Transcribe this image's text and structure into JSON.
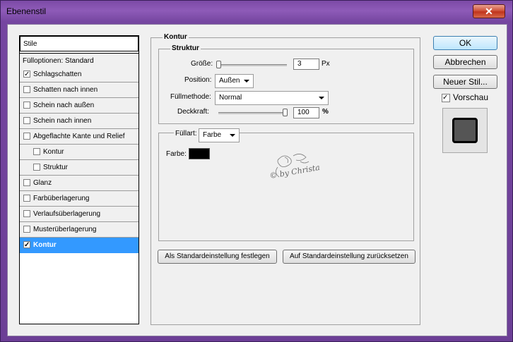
{
  "window": {
    "title": "Ebenenstil",
    "close_glyph": "✕"
  },
  "styles_list": {
    "header": "Stile",
    "items": [
      {
        "label": "Fülloptionen: Standard",
        "checkbox": false,
        "checked": false,
        "indent": 0
      },
      {
        "label": "Schlagschatten",
        "checkbox": true,
        "checked": true,
        "indent": 0
      },
      {
        "label": "Schatten nach innen",
        "checkbox": true,
        "checked": false,
        "indent": 0
      },
      {
        "label": "Schein nach außen",
        "checkbox": true,
        "checked": false,
        "indent": 0
      },
      {
        "label": "Schein nach innen",
        "checkbox": true,
        "checked": false,
        "indent": 0
      },
      {
        "label": "Abgeflachte Kante und Relief",
        "checkbox": true,
        "checked": false,
        "indent": 0
      },
      {
        "label": "Kontur",
        "checkbox": true,
        "checked": false,
        "indent": 1
      },
      {
        "label": "Struktur",
        "checkbox": true,
        "checked": false,
        "indent": 1
      },
      {
        "label": "Glanz",
        "checkbox": true,
        "checked": false,
        "indent": 0
      },
      {
        "label": "Farbüberlagerung",
        "checkbox": true,
        "checked": false,
        "indent": 0
      },
      {
        "label": "Verlaufsüberlagerung",
        "checkbox": true,
        "checked": false,
        "indent": 0
      },
      {
        "label": "Musterüberlagerung",
        "checkbox": true,
        "checked": false,
        "indent": 0
      },
      {
        "label": "Kontur",
        "checkbox": true,
        "checked": true,
        "indent": 0,
        "selected": true
      }
    ]
  },
  "kontur": {
    "title": "Kontur",
    "struktur": {
      "title": "Struktur",
      "size_label": "Größe:",
      "size_value": "3",
      "size_unit": "Px",
      "size_slider_fraction": 0.0,
      "position_label": "Position:",
      "position_value": "Außen",
      "blend_label": "Füllmethode:",
      "blend_value": "Normal",
      "opacity_label": "Deckkraft:",
      "opacity_value": "100",
      "opacity_unit": "%",
      "opacity_slider_fraction": 1.0
    },
    "fill": {
      "filltype_label": "Füllart:",
      "filltype_value": "Farbe",
      "color_label": "Farbe:",
      "color_swatch": "#000000",
      "watermark": "© by Christa"
    },
    "btn_make_default": "Als Standardeinstellung festlegen",
    "btn_reset_default": "Auf Standardeinstellung zurücksetzen"
  },
  "actions": {
    "ok": "OK",
    "cancel": "Abbrechen",
    "new_style": "Neuer Stil...",
    "preview_label": "Vorschau",
    "preview_checked": true
  }
}
